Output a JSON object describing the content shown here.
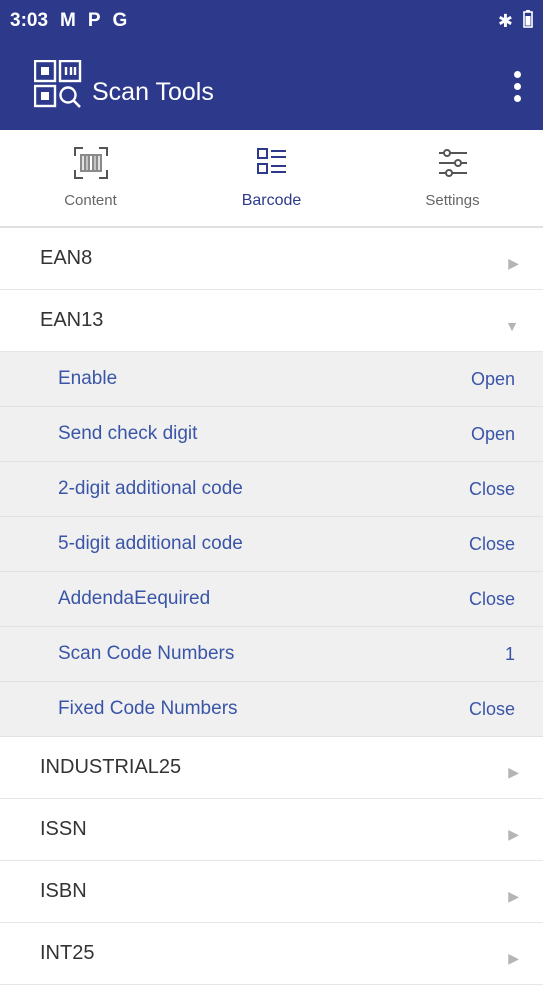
{
  "status_bar": {
    "time": "3:03",
    "indicators": [
      "M",
      "P",
      "G"
    ],
    "right_icons": [
      "bluetooth-icon",
      "battery-icon"
    ]
  },
  "app_bar": {
    "title": "Scan Tools",
    "icon": "scan-tools-logo-icon",
    "menu_icon": "overflow-menu-icon"
  },
  "tabs": [
    {
      "label": "Content",
      "icon": "content-scan-icon",
      "active": false
    },
    {
      "label": "Barcode",
      "icon": "barcode-list-icon",
      "active": true
    },
    {
      "label": "Settings",
      "icon": "settings-sliders-icon",
      "active": false
    }
  ],
  "barcodes": {
    "ean8": "EAN8",
    "ean13": "EAN13",
    "ean13_settings": [
      {
        "label": "Enable",
        "value": "Open"
      },
      {
        "label": "Send check digit",
        "value": "Open"
      },
      {
        "label": "2-digit additional code",
        "value": "Close"
      },
      {
        "label": "5-digit additional code",
        "value": "Close"
      },
      {
        "label": "AddendaEequired",
        "value": "Close"
      },
      {
        "label": "Scan Code Numbers",
        "value": "1"
      },
      {
        "label": "Fixed Code Numbers",
        "value": "Close"
      }
    ],
    "after": [
      "INDUSTRIAL25",
      "ISSN",
      "ISBN",
      "INT25"
    ]
  },
  "colors": {
    "primary": "#2d3a8c",
    "sub_text": "#3a55a8",
    "sub_bg": "#f0f0f0"
  }
}
